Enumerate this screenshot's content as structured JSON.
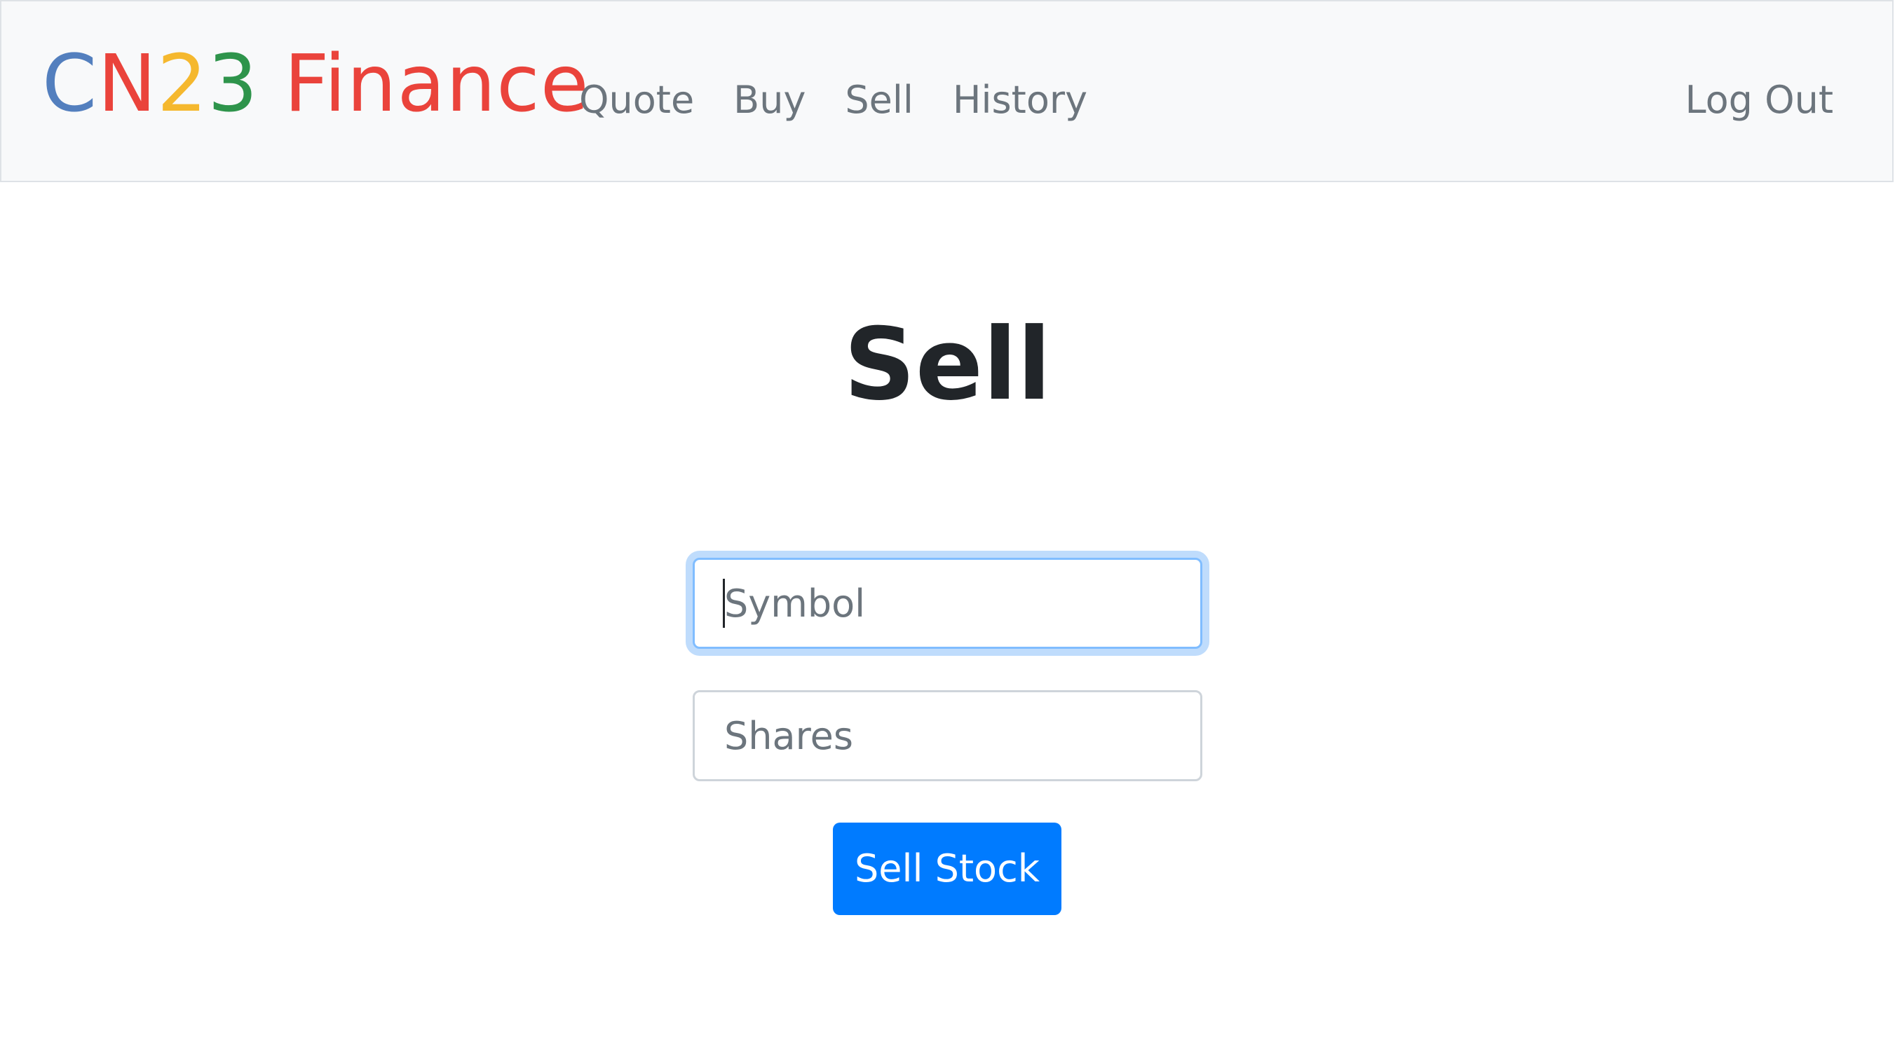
{
  "brand": {
    "letters": [
      {
        "char": "C",
        "color": "#537fbe"
      },
      {
        "char": "N",
        "color": "#ea433b"
      },
      {
        "char": "2",
        "color": "#f5b82e"
      },
      {
        "char": "3",
        "color": "#2e944b"
      },
      {
        "char": " Finance",
        "color": "#ea433b"
      }
    ]
  },
  "nav": {
    "quote": "Quote",
    "buy": "Buy",
    "sell": "Sell",
    "history": "History",
    "logout": "Log Out"
  },
  "page": {
    "title": "Sell"
  },
  "form": {
    "symbol": {
      "placeholder": "Symbol",
      "value": ""
    },
    "shares": {
      "placeholder": "Shares",
      "value": ""
    },
    "submit_label": "Sell Stock"
  },
  "colors": {
    "primary": "#007bff",
    "navbar_bg": "#f8f9fa",
    "nav_link": "#6c757d",
    "title": "#212529"
  }
}
